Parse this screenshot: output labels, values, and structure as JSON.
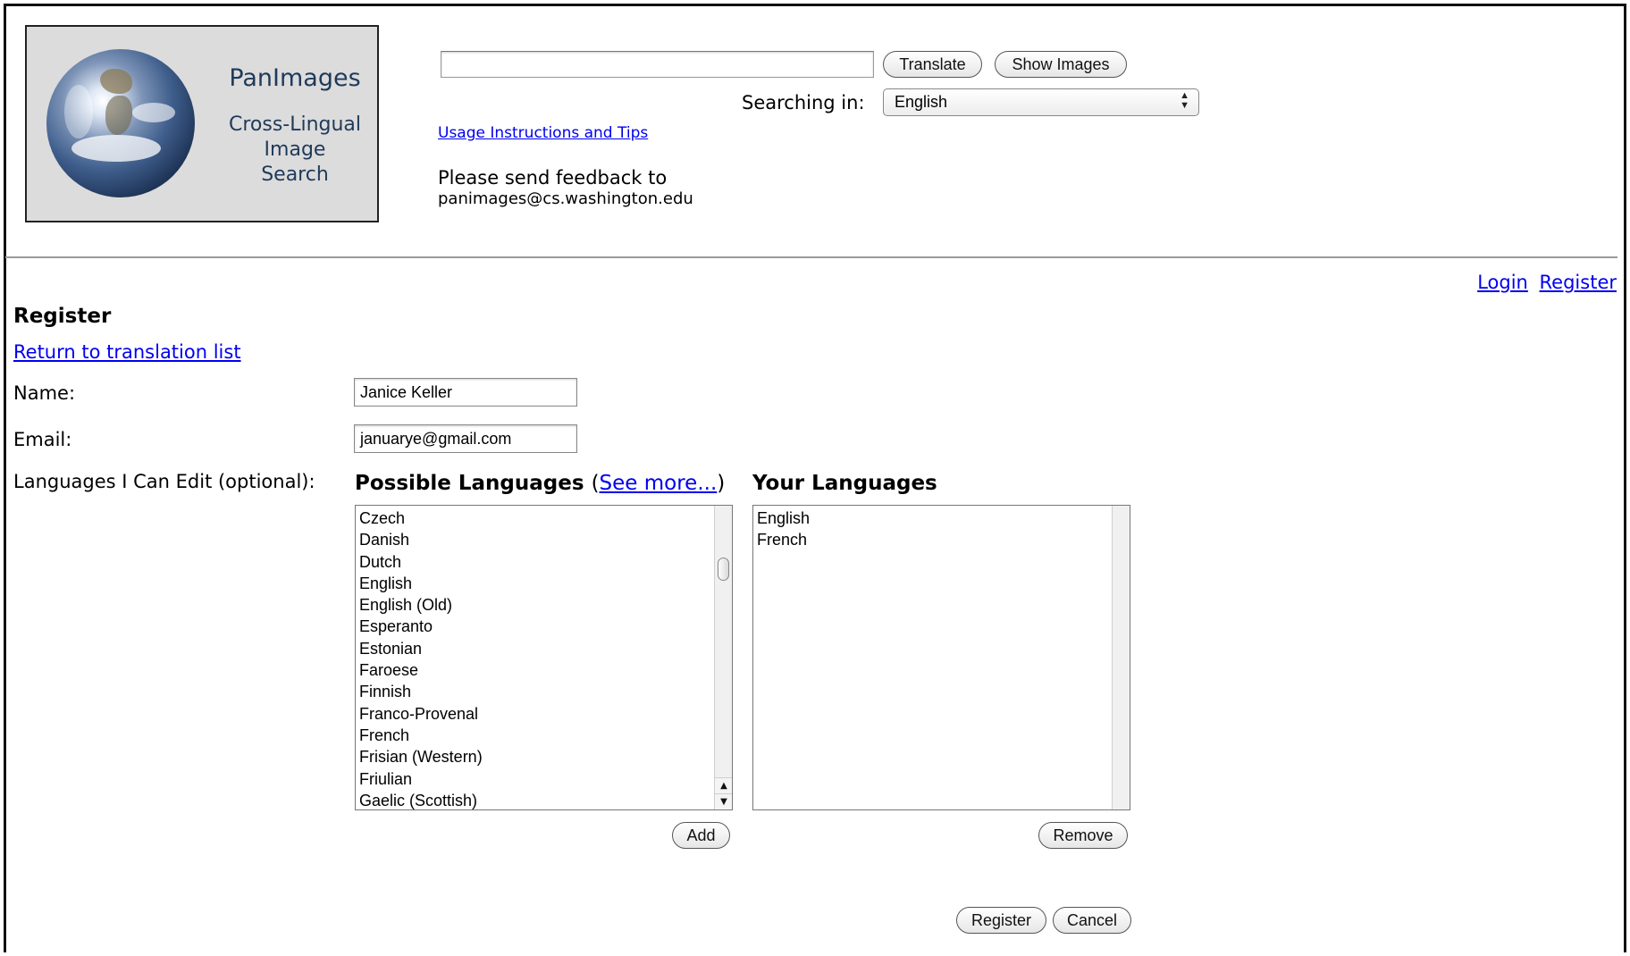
{
  "header": {
    "logo": {
      "title": "PanImages",
      "subtitle_lines": [
        "Cross-Lingual",
        "Image",
        "Search"
      ]
    },
    "search": {
      "value": "",
      "translate_label": "Translate",
      "show_images_label": "Show Images",
      "searching_in_label": "Searching in:",
      "searching_in_value": "English"
    },
    "usage_link": "Usage Instructions and Tips",
    "feedback_text": "Please send feedback to",
    "feedback_email": "panimages@cs.washington.edu"
  },
  "top_links": {
    "login": "Login",
    "register": "Register"
  },
  "form": {
    "title": "Register",
    "return_link": "Return to translation list",
    "name_label": "Name:",
    "name_value": "Janice Keller",
    "email_label": "Email:",
    "email_value": "januarye@gmail.com",
    "languages_label": "Languages I Can Edit (optional):",
    "possible_heading": "Possible Languages",
    "see_more": "See more...",
    "your_heading": "Your Languages",
    "possible_languages": [
      "Czech",
      "Danish",
      "Dutch",
      "English",
      "English (Old)",
      "Esperanto",
      "Estonian",
      "Faroese",
      "Finnish",
      "Franco-Provenal",
      "French",
      "Frisian (Western)",
      "Friulian",
      "Gaelic (Scottish)"
    ],
    "your_languages": [
      "English",
      "French"
    ],
    "add_label": "Add",
    "remove_label": "Remove",
    "register_label": "Register",
    "cancel_label": "Cancel"
  }
}
